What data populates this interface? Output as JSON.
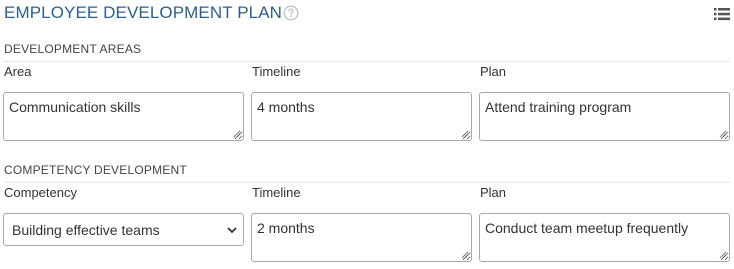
{
  "header": {
    "title": "EMPLOYEE DEVELOPMENT PLAN",
    "help_icon": "question-circle-icon",
    "menu_icon": "list-icon"
  },
  "development_areas": {
    "section_title": "DEVELOPMENT AREAS",
    "columns": [
      "Area",
      "Timeline",
      "Plan"
    ],
    "row": {
      "area": "Communication skills",
      "timeline": "4 months",
      "plan": "Attend training program"
    }
  },
  "competency_development": {
    "section_title": "COMPETENCY DEVELOPMENT",
    "columns": [
      "Competency",
      "Timeline",
      "Plan"
    ],
    "row": {
      "competency": "Building effective teams",
      "timeline": "2 months",
      "plan": "Conduct team meetup frequently"
    }
  },
  "colors": {
    "title": "#2e5f8c",
    "border": "#a9a9a9",
    "icon": "#555555"
  }
}
